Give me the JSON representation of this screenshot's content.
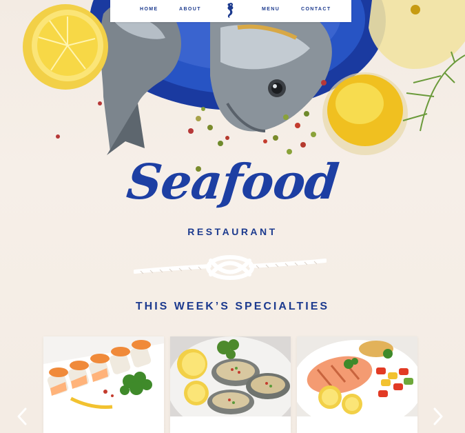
{
  "nav": {
    "items": [
      {
        "label": "HOME"
      },
      {
        "label": "ABOUT"
      },
      {
        "label": "MENU"
      },
      {
        "label": "CONTACT"
      }
    ],
    "logo_icon": "seahorse-icon"
  },
  "hero": {
    "title": "Seafood",
    "subtitle": "RESTAURANT",
    "divider_icon": "rope-knot-icon"
  },
  "specials": {
    "heading": "THIS WEEK’S SPECIALTIES",
    "cards": [
      {
        "image": "sushi-rolls-image"
      },
      {
        "image": "oysters-image"
      },
      {
        "image": "grilled-salmon-image"
      }
    ],
    "prev_icon": "chevron-left-icon",
    "next_icon": "chevron-right-icon"
  },
  "colors": {
    "brand_blue": "#1c3a8e",
    "background": "#f4ece4",
    "plate_blue": "#1f46b0"
  }
}
